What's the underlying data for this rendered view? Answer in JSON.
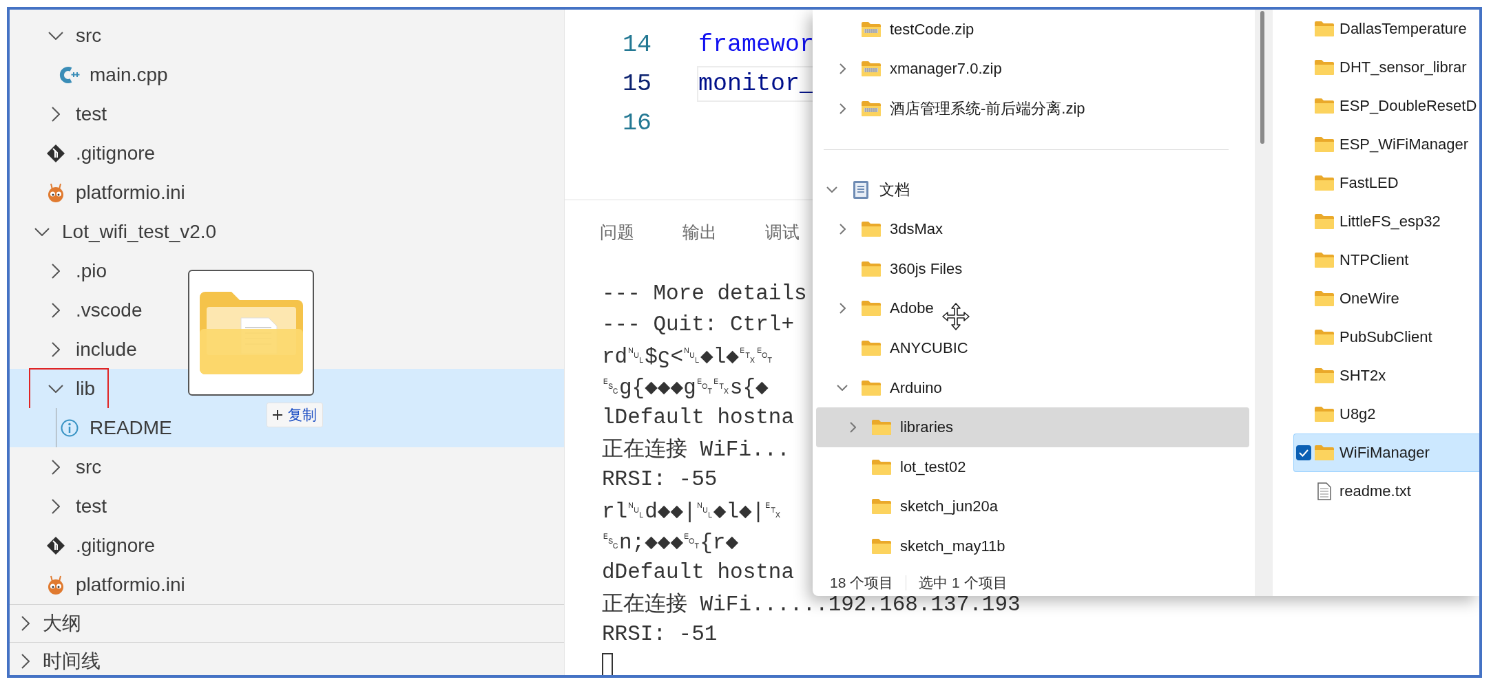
{
  "sidebar": {
    "previous_project_items": [
      {
        "label": "src",
        "kind": "folder",
        "expanded": true,
        "children": [
          {
            "label": "main.cpp",
            "kind": "cpp"
          }
        ]
      },
      {
        "label": "test",
        "kind": "folder",
        "expanded": false
      },
      {
        "label": ".gitignore",
        "kind": "git"
      },
      {
        "label": "platformio.ini",
        "kind": "platformio"
      }
    ],
    "projects": [
      {
        "label": "Lot_wifi_test_v2.0",
        "kind": "folder",
        "expanded": true,
        "children": [
          {
            "label": ".pio",
            "kind": "folder",
            "expanded": false
          },
          {
            "label": ".vscode",
            "kind": "folder",
            "expanded": false
          },
          {
            "label": "include",
            "kind": "folder",
            "expanded": false
          },
          {
            "label": "lib",
            "kind": "folder",
            "expanded": true,
            "drop_target": true,
            "outlined": true,
            "children": [
              {
                "label": "README",
                "kind": "info"
              }
            ]
          },
          {
            "label": "src",
            "kind": "folder",
            "expanded": false
          },
          {
            "label": "test",
            "kind": "folder",
            "expanded": false
          },
          {
            "label": ".gitignore",
            "kind": "git"
          },
          {
            "label": "platformio.ini",
            "kind": "platformio"
          }
        ]
      }
    ],
    "sections": [
      {
        "label": "大纲",
        "expanded": false
      },
      {
        "label": "时间线",
        "expanded": false
      }
    ]
  },
  "drag_preview": {
    "badge": "复制"
  },
  "editor": {
    "lines": [
      {
        "number": "14",
        "code": "framewor",
        "current": false
      },
      {
        "number": "15",
        "code": "monitor_",
        "current": true
      },
      {
        "number": "16",
        "current": false
      }
    ]
  },
  "panel": {
    "tabs": [
      {
        "label": "问题",
        "selected": false
      },
      {
        "label": "输出",
        "selected": false
      },
      {
        "label": "调试",
        "selected": false
      }
    ],
    "terminal_lines": [
      "--- More details",
      "--- Quit: Ctrl+",
      "rd␀$ϛ<␀◆l◆␃␄",
      "␛g{◆◆◆g␄␃s{◆",
      "lDefault hostna",
      "正在连接 WiFi...",
      "RRSI: -55",
      "rl␀d◆◆|␀◆l◆|␃",
      "␛n;◆◆◆␄{r◆",
      "dDefault hostna",
      "正在连接 WiFi......192.168.137.193",
      "RRSI: -51"
    ]
  },
  "file_explorer": {
    "nav_items_above": [
      {
        "label": "testCode.zip",
        "kind": "zip",
        "expandable": false,
        "selected": false
      },
      {
        "label": "xmanager7.0.zip",
        "kind": "zip",
        "expandable": true,
        "expanded": false,
        "selected": false
      },
      {
        "label": "酒店管理系统-前后端分离.zip",
        "kind": "zip",
        "expandable": true,
        "expanded": false,
        "selected": false
      }
    ],
    "nav_tree": [
      {
        "label": "文档",
        "kind": "documents",
        "expandable": true,
        "expanded": true,
        "selected": false,
        "children": [
          {
            "label": "3dsMax",
            "kind": "folder",
            "expandable": true,
            "expanded": false,
            "selected": false
          },
          {
            "label": "360js Files",
            "kind": "folder",
            "expandable": false,
            "selected": false
          },
          {
            "label": "Adobe",
            "kind": "folder",
            "expandable": true,
            "expanded": false,
            "selected": false
          },
          {
            "label": "ANYCUBIC",
            "kind": "folder",
            "expandable": false,
            "selected": false
          },
          {
            "label": "Arduino",
            "kind": "folder",
            "expandable": true,
            "expanded": true,
            "selected": false,
            "children": [
              {
                "label": "libraries",
                "kind": "folder",
                "expandable": true,
                "expanded": false,
                "selected": true
              },
              {
                "label": "lot_test02",
                "kind": "folder",
                "expandable": false,
                "selected": false
              },
              {
                "label": "sketch_jun20a",
                "kind": "folder",
                "expandable": false,
                "selected": false
              },
              {
                "label": "sketch_may11b",
                "kind": "folder",
                "expandable": false,
                "selected": false
              }
            ]
          }
        ]
      }
    ],
    "items": [
      {
        "name": "DallasTemperature",
        "kind": "folder",
        "selected": false
      },
      {
        "name": "DHT_sensor_librar",
        "kind": "folder",
        "selected": false
      },
      {
        "name": "ESP_DoubleResetD",
        "kind": "folder",
        "selected": false
      },
      {
        "name": "ESP_WiFiManager",
        "kind": "folder",
        "selected": false
      },
      {
        "name": "FastLED",
        "kind": "folder",
        "selected": false
      },
      {
        "name": "LittleFS_esp32",
        "kind": "folder",
        "selected": false
      },
      {
        "name": "NTPClient",
        "kind": "folder",
        "selected": false
      },
      {
        "name": "OneWire",
        "kind": "folder",
        "selected": false
      },
      {
        "name": "PubSubClient",
        "kind": "folder",
        "selected": false
      },
      {
        "name": "SHT2x",
        "kind": "folder",
        "selected": false
      },
      {
        "name": "U8g2",
        "kind": "folder",
        "selected": false
      },
      {
        "name": "WiFiManager",
        "kind": "folder",
        "selected": true
      },
      {
        "name": "readme.txt",
        "kind": "file",
        "selected": false
      }
    ],
    "status": {
      "item_count": "18 个项目",
      "selection": "选中 1 个项目"
    }
  }
}
